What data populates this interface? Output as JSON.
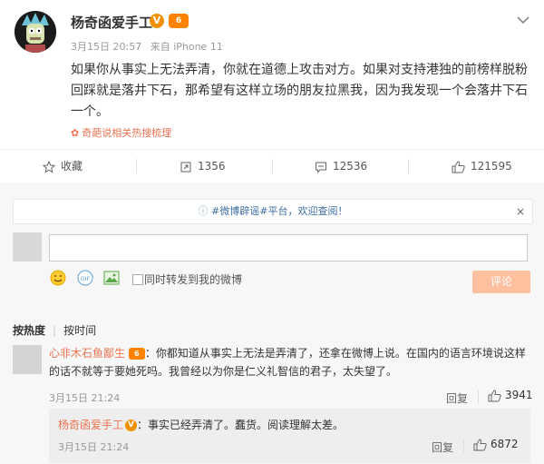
{
  "post": {
    "author": "杨奇函爱手工",
    "verified_badge": "V",
    "vip_badge": "6",
    "date": "3月15日 20:57",
    "source": "来自 iPhone 11",
    "text": "如果你从事实上无法弄清，你就在道德上攻击对方。如果对支持港独的前榜样脱粉回踩就是落井下石，那希望有这样立场的朋友拉黑我，因为我发现一个会落井下石一个。",
    "hashtag": "奇葩说相关热搜梳理"
  },
  "actions": {
    "favorite": "收藏",
    "repost": "1356",
    "comment": "12536",
    "like": "121595"
  },
  "notice": {
    "text": "#微博辟谣#平台，欢迎查阅！",
    "close": "×"
  },
  "composer": {
    "input_value": "",
    "repost_label": "同时转发到我的微博",
    "submit_label": "评论"
  },
  "sort": {
    "hot": "按热度",
    "time": "按时间"
  },
  "comments": [
    {
      "author": "心非木石鱼鄙生",
      "vip_badge": "6",
      "text": "：你都知道从事实上无法是弄清了，还拿在微博上说。在国内的语言环境说这样的话不就等于要她死吗。我曾经以为你是仁义礼智信的君子，太失望了。",
      "time": "3月15日 21:24",
      "reply_label": "回复",
      "likes": "3941",
      "replies": [
        {
          "author": "杨奇函爱手工",
          "verified_badge": "V",
          "text": "：事实已经弄清了。蠢货。阅读理解太差。",
          "time": "3月15日 21:24",
          "reply_label": "回复",
          "likes": "6872"
        }
      ]
    }
  ],
  "colors": {
    "accent": "#eb7350",
    "link_blue": "#3e6ea0",
    "submit_disabled": "#ffc09f",
    "badge_orange": "#ff8200"
  }
}
